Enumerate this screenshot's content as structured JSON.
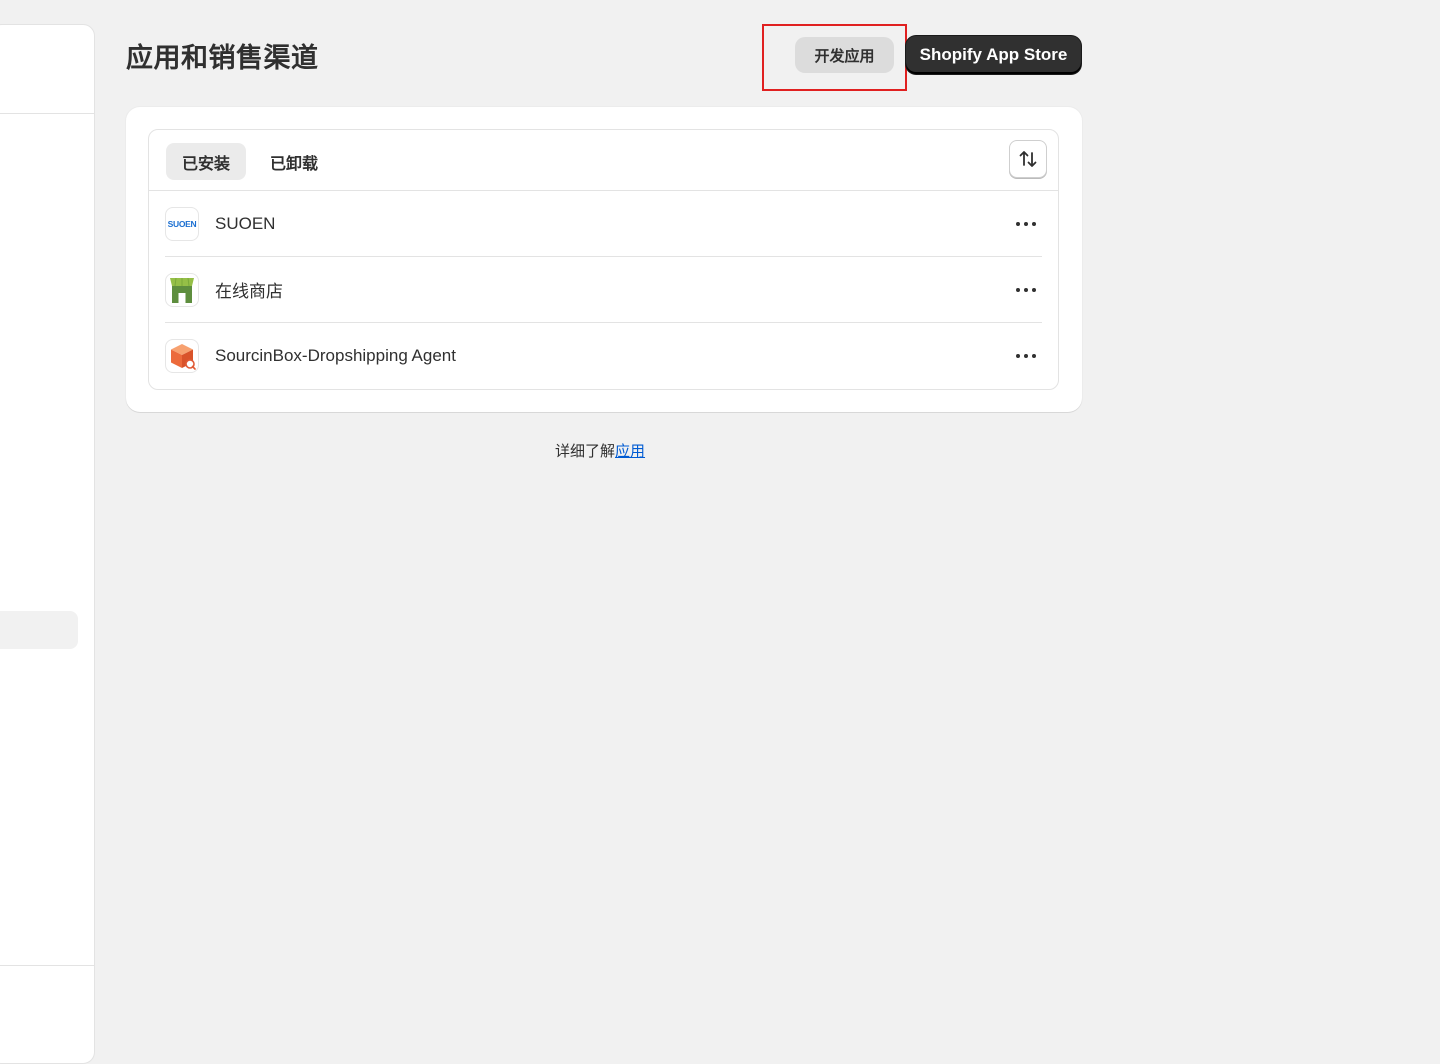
{
  "header": {
    "title": "应用和销售渠道",
    "develop_button": "开发应用",
    "store_button": "Shopify App Store"
  },
  "tabs": [
    {
      "label": "已安装",
      "active": true
    },
    {
      "label": "已卸载",
      "active": false
    }
  ],
  "apps": [
    {
      "name": "SUOEN",
      "icon": "suoen-logo",
      "icon_text": "SUOEN"
    },
    {
      "name": "在线商店",
      "icon": "online-store-icon"
    },
    {
      "name": "SourcinBox-Dropshipping Agent",
      "icon": "sourcinbox-icon"
    }
  ],
  "footer": {
    "prefix": "详细了解",
    "link": "应用"
  },
  "colors": {
    "primary_button": "#303030",
    "link": "#005bd3",
    "highlight": "#e02020"
  }
}
